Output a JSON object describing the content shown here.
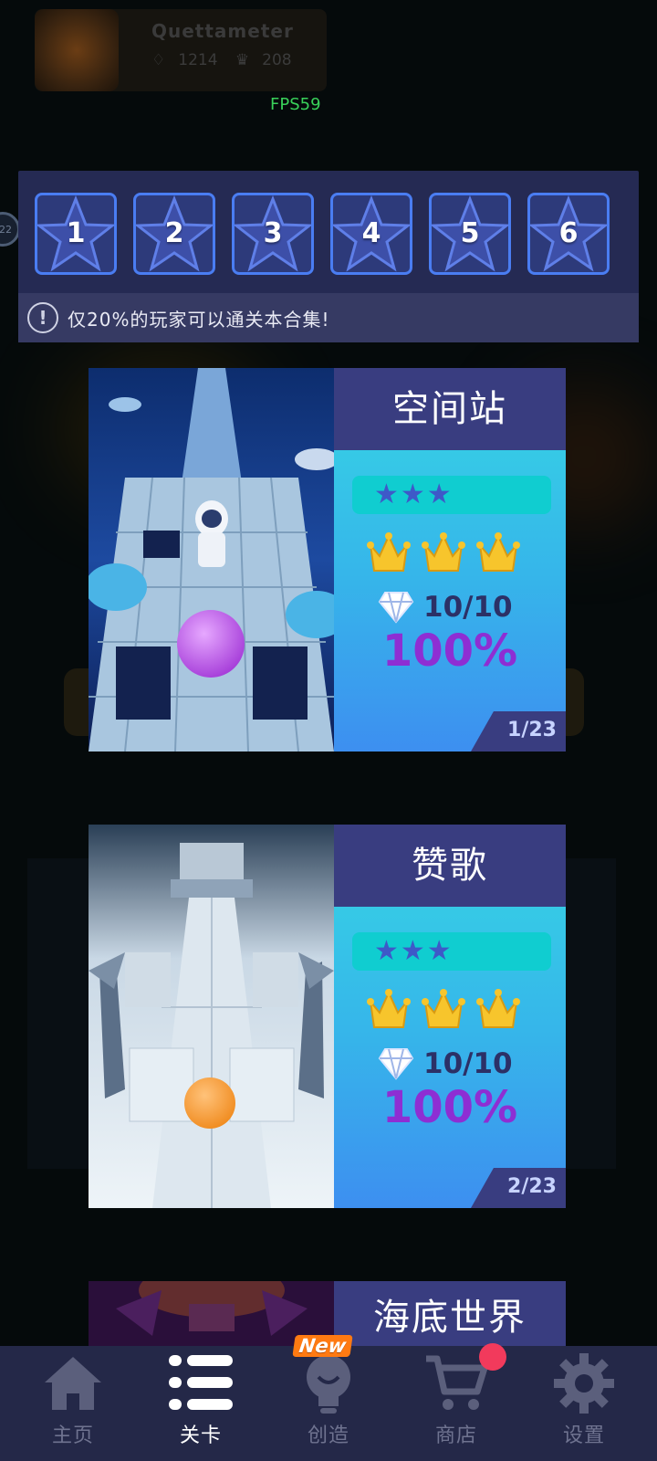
{
  "background": {
    "profile": {
      "name": "Quettameter",
      "gems": "1214",
      "crowns": "208"
    },
    "fps": "FPS59",
    "side_badge": "22"
  },
  "level_selector": {
    "levels": [
      "1",
      "2",
      "3",
      "4",
      "5",
      "6"
    ],
    "notice_icon": "!",
    "notice_text": "仅20%的玩家可以通关本合集!"
  },
  "cards": [
    {
      "title": "空间站",
      "stars": "★★★",
      "gems": "10/10",
      "percent": "100%",
      "page": "1/23",
      "art": "space-station-scene"
    },
    {
      "title": "赞歌",
      "stars": "★★★",
      "gems": "10/10",
      "percent": "100%",
      "page": "2/23",
      "art": "anthem-ice-temple-scene"
    },
    {
      "title": "海底世界",
      "art": "undersea-world-scene"
    }
  ],
  "bottom_nav": {
    "items": [
      {
        "label": "主页",
        "icon": "home-icon"
      },
      {
        "label": "关卡",
        "icon": "list-icon",
        "active": true
      },
      {
        "label": "创造",
        "icon": "lightbulb-icon",
        "badge": "New"
      },
      {
        "label": "商店",
        "icon": "cart-icon",
        "notification": true
      },
      {
        "label": "设置",
        "icon": "gear-icon"
      }
    ]
  },
  "colors": {
    "panel": "#252a53",
    "tile_border": "#4a7df2",
    "card_title_bg": "#393d80",
    "percent": "#8e2ed3",
    "nav_bg": "#242848"
  }
}
